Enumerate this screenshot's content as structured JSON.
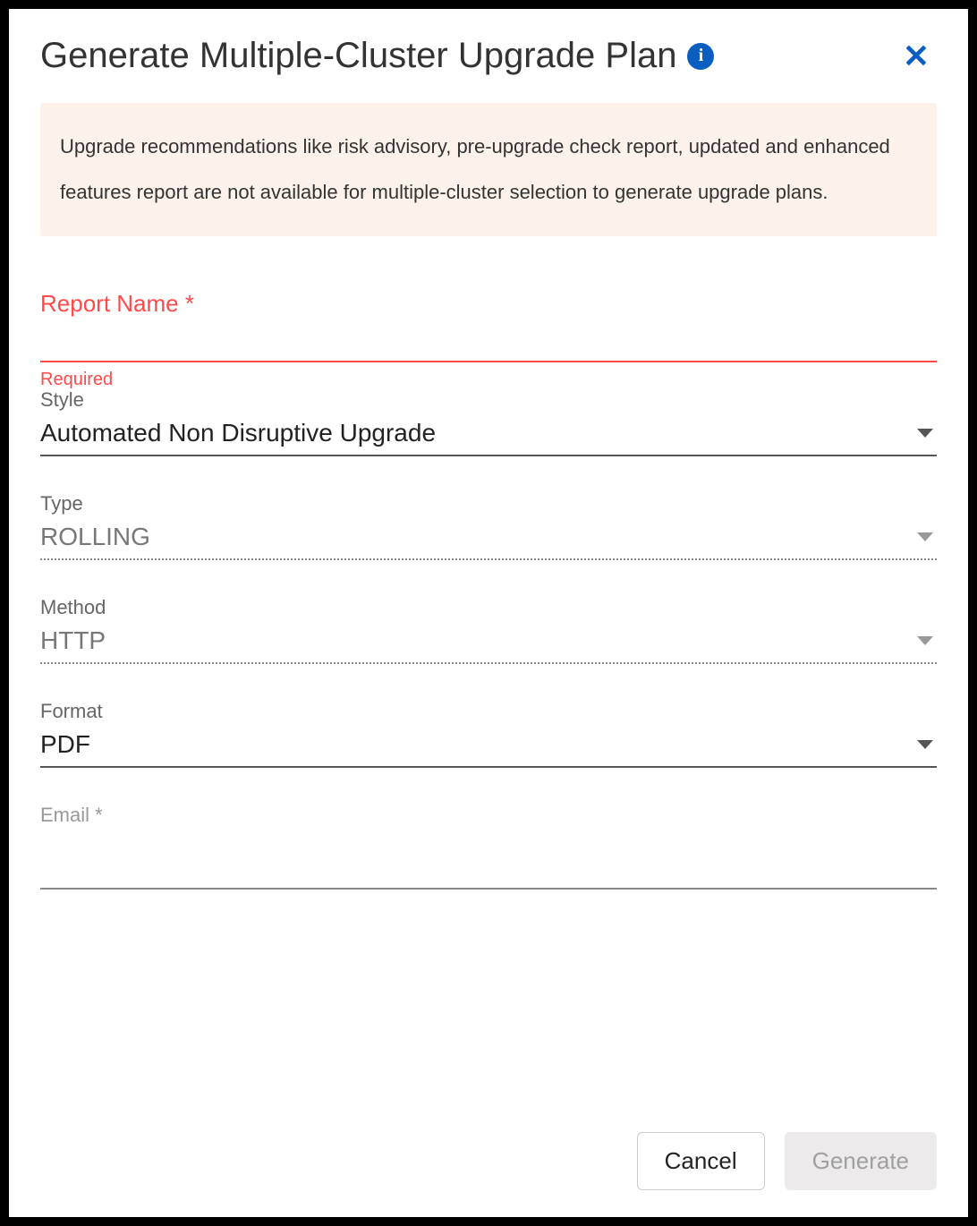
{
  "dialog": {
    "title": "Generate Multiple-Cluster Upgrade Plan",
    "notice": "Upgrade recommendations like risk advisory, pre-upgrade check report, updated and enhanced features report are not available for multiple-cluster selection to generate upgrade plans."
  },
  "form": {
    "reportName": {
      "label": "Report Name *",
      "value": "",
      "requiredMsg": "Required"
    },
    "style": {
      "label": "Style",
      "value": "Automated Non Disruptive Upgrade"
    },
    "type": {
      "label": "Type",
      "value": "ROLLING"
    },
    "method": {
      "label": "Method",
      "value": "HTTP"
    },
    "format": {
      "label": "Format",
      "value": "PDF"
    },
    "email": {
      "label": "Email *",
      "value": ""
    }
  },
  "buttons": {
    "cancel": "Cancel",
    "generate": "Generate"
  }
}
